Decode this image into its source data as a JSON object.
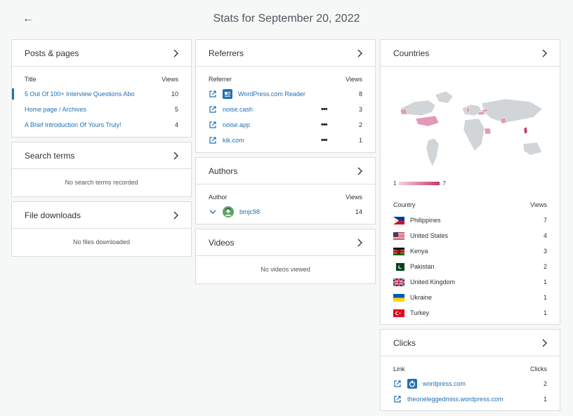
{
  "header": {
    "title": "Stats for September 20, 2022"
  },
  "posts": {
    "title": "Posts & pages",
    "col_left": "Title",
    "col_right": "Views",
    "rows": [
      {
        "label": "5 Out Of 100+ Interview Questions Abo",
        "value": "10"
      },
      {
        "label": "Home page / Archives",
        "value": "5"
      },
      {
        "label": "A Brief Introduction Of Yours Truly!",
        "value": "4"
      }
    ]
  },
  "search": {
    "title": "Search terms",
    "empty": "No search terms recorded"
  },
  "files": {
    "title": "File downloads",
    "empty": "No files downloaded"
  },
  "referrers": {
    "title": "Referrers",
    "col_left": "Referrer",
    "col_right": "Views",
    "rows": [
      {
        "label": "WordPress.com Reader",
        "value": "8"
      },
      {
        "label": "noise.cash",
        "value": "3"
      },
      {
        "label": "noise.app",
        "value": "2"
      },
      {
        "label": "kik.com",
        "value": "1"
      }
    ]
  },
  "authors": {
    "title": "Authors",
    "col_left": "Author",
    "col_right": "Views",
    "rows": [
      {
        "label": "bmjc98",
        "value": "14"
      }
    ]
  },
  "videos": {
    "title": "Videos",
    "empty": "No videos viewed"
  },
  "countries": {
    "title": "Countries",
    "legend_min": "1",
    "legend_max": "7",
    "col_left": "Country",
    "col_right": "Views",
    "rows": [
      {
        "label": "Philippines",
        "value": "7"
      },
      {
        "label": "United States",
        "value": "4"
      },
      {
        "label": "Kenya",
        "value": "3"
      },
      {
        "label": "Pakistan",
        "value": "2"
      },
      {
        "label": "United Kingdom",
        "value": "1"
      },
      {
        "label": "Ukraine",
        "value": "1"
      },
      {
        "label": "Turkey",
        "value": "1"
      }
    ]
  },
  "clicks": {
    "title": "Clicks",
    "col_left": "Link",
    "col_right": "Clicks",
    "rows": [
      {
        "label": "wordpress.com",
        "value": "2"
      },
      {
        "label": "theoneleggedmiss.wordpress.com",
        "value": "1"
      }
    ]
  },
  "colors": {
    "link": "#2271b1",
    "map_fill": "#d1d5d8",
    "map_high": "#c9356e",
    "map_mid": "#e29ab5"
  }
}
